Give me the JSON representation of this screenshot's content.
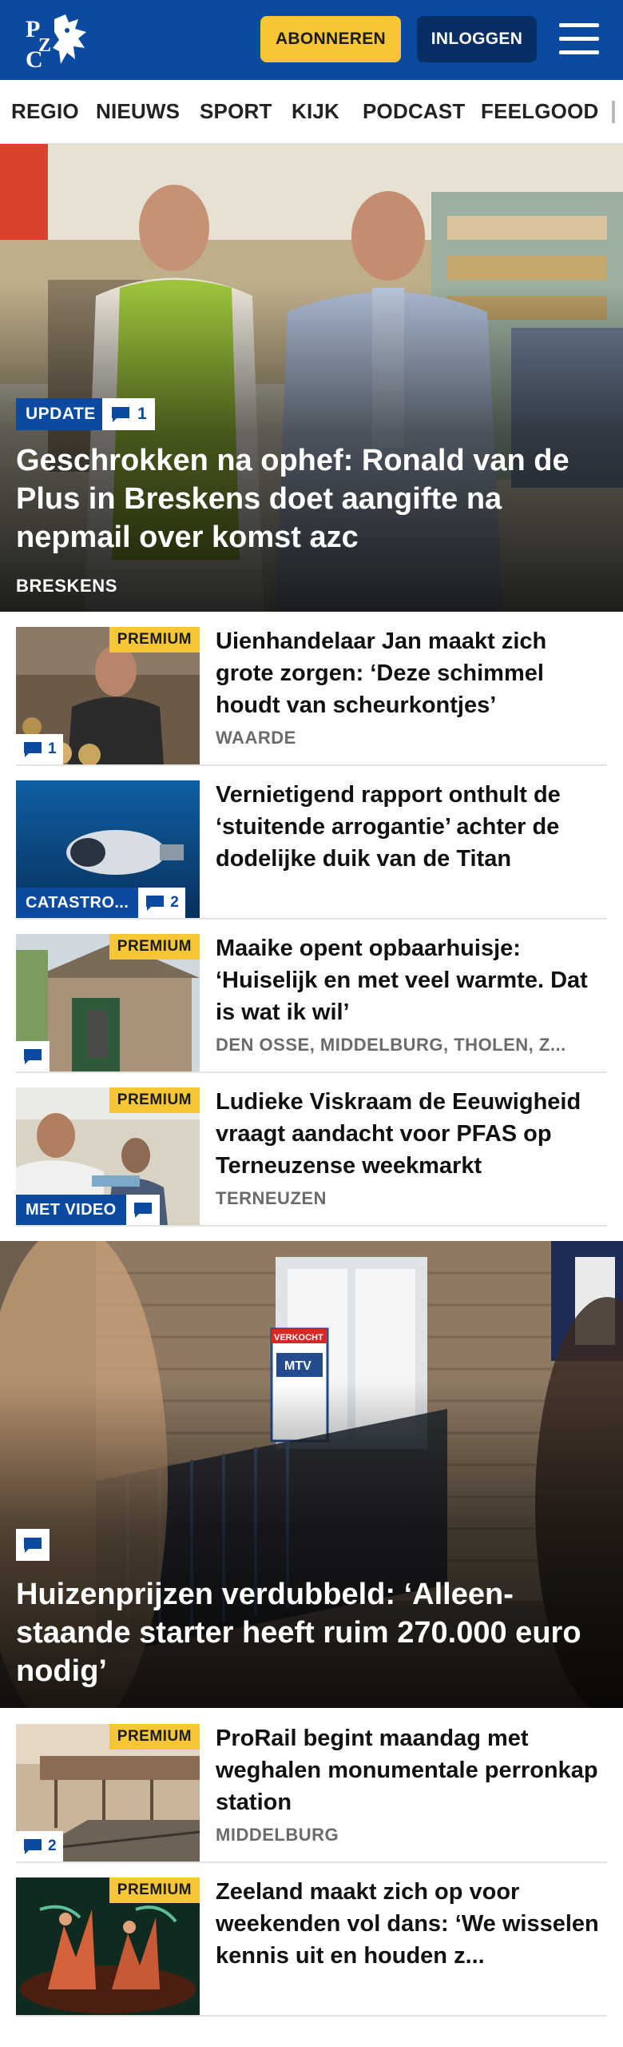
{
  "header": {
    "logo_alt": "PZC",
    "subscribe_label": "ABONNEREN",
    "login_label": "INLOGGEN",
    "colors": {
      "brand": "#0a4aa0",
      "accent": "#f6c634"
    }
  },
  "nav": {
    "items": [
      {
        "label": "REGIO"
      },
      {
        "label": "NIEUWS"
      },
      {
        "label": "SPORT"
      },
      {
        "label": "KIJK"
      },
      {
        "label": "PODCAST"
      },
      {
        "label": "FEELGOOD"
      }
    ]
  },
  "hero1": {
    "badge": "UPDATE",
    "comments": "1",
    "title": "Geschrokken na ophef: Ronald van de Plus in Breskens doet aangifte na nepmail over komst azc",
    "region": "BRESKENS"
  },
  "list1": [
    {
      "premium": "PREMIUM",
      "comments": "1",
      "title": "Uienhandelaar Jan maakt zich grote zorgen: ‘Deze schimmel houdt van scheurkontjes’",
      "region": "WAARDE"
    },
    {
      "label": "CATASTRO...",
      "comments": "2",
      "title": "Vernietigend rapport onthult de ‘stuitende arrogantie’ achter de dodelijke duik van de Titan"
    },
    {
      "premium": "PREMIUM",
      "title": "Maaike opent opbaarhuisje: ‘Huiselijk en met veel warmte. Dat is wat ik wil’",
      "region": "DEN OSSE, MIDDELBURG, THOLEN, Z..."
    },
    {
      "premium": "PREMIUM",
      "label": "MET VIDEO",
      "title": "Ludieke Viskraam de Eeuwigheid vraagt aandacht voor PFAS op Terneuzense weekmarkt",
      "region": "TERNEUZEN"
    }
  ],
  "hero2": {
    "title": "Huizenprijzen verdubbeld: ‘Alleen-staande starter heeft ruim 270.000 euro nodig’",
    "sign_text_1": "VERKOCHT",
    "sign_text_2": "MTV"
  },
  "list2": [
    {
      "premium": "PREMIUM",
      "comments": "2",
      "title": "ProRail begint maandag met weghalen monumentale perronkap station",
      "region": "MIDDELBURG"
    },
    {
      "premium": "PREMIUM",
      "title": "Zeeland maakt zich op voor weekenden vol dans: ‘We wisselen kennis uit en houden z..."
    }
  ]
}
